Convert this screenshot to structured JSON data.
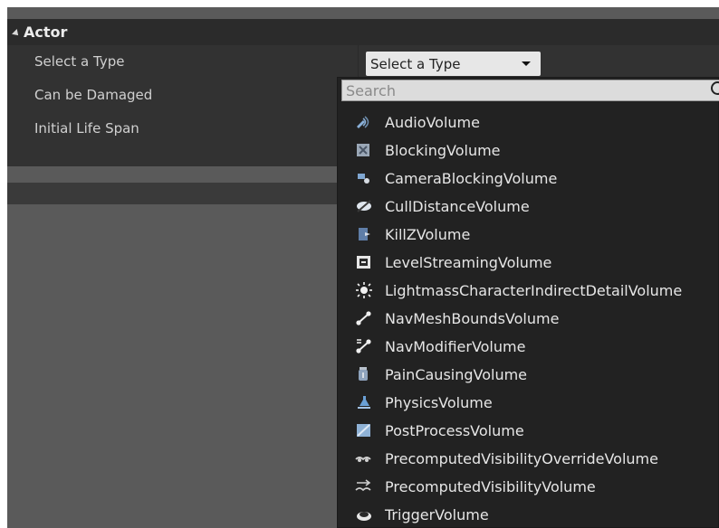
{
  "section": {
    "title": "Actor"
  },
  "rows": [
    {
      "label": "Select a Type"
    },
    {
      "label": "Can be Damaged"
    },
    {
      "label": "Initial Life Span"
    }
  ],
  "combo": {
    "value": "Select a Type"
  },
  "search": {
    "placeholder": "Search"
  },
  "menu": {
    "items": [
      {
        "label": "AudioVolume",
        "icon": "audio-volume-icon"
      },
      {
        "label": "BlockingVolume",
        "icon": "blocking-volume-icon"
      },
      {
        "label": "CameraBlockingVolume",
        "icon": "camera-blocking-volume-icon"
      },
      {
        "label": "CullDistanceVolume",
        "icon": "cull-distance-volume-icon"
      },
      {
        "label": "KillZVolume",
        "icon": "killz-volume-icon"
      },
      {
        "label": "LevelStreamingVolume",
        "icon": "level-streaming-volume-icon"
      },
      {
        "label": "LightmassCharacterIndirectDetailVolume",
        "icon": "lightmass-volume-icon"
      },
      {
        "label": "NavMeshBoundsVolume",
        "icon": "nav-mesh-bounds-volume-icon"
      },
      {
        "label": "NavModifierVolume",
        "icon": "nav-modifier-volume-icon"
      },
      {
        "label": "PainCausingVolume",
        "icon": "pain-causing-volume-icon"
      },
      {
        "label": "PhysicsVolume",
        "icon": "physics-volume-icon"
      },
      {
        "label": "PostProcessVolume",
        "icon": "post-process-volume-icon"
      },
      {
        "label": "PrecomputedVisibilityOverrideVolume",
        "icon": "precomputed-visibility-override-volume-icon"
      },
      {
        "label": "PrecomputedVisibilityVolume",
        "icon": "precomputed-visibility-volume-icon"
      },
      {
        "label": "TriggerVolume",
        "icon": "trigger-volume-icon"
      }
    ]
  }
}
